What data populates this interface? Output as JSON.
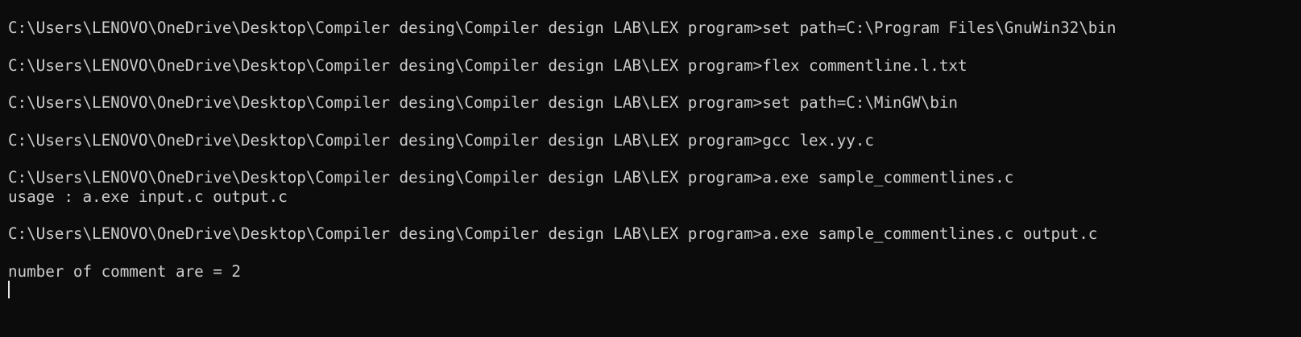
{
  "terminal": {
    "lines": [
      "C:\\Users\\LENOVO\\OneDrive\\Desktop\\Compiler desing\\Compiler design LAB\\LEX program>set path=C:\\Program Files\\GnuWin32\\bin",
      "",
      "C:\\Users\\LENOVO\\OneDrive\\Desktop\\Compiler desing\\Compiler design LAB\\LEX program>flex commentline.l.txt",
      "",
      "C:\\Users\\LENOVO\\OneDrive\\Desktop\\Compiler desing\\Compiler design LAB\\LEX program>set path=C:\\MinGW\\bin",
      "",
      "C:\\Users\\LENOVO\\OneDrive\\Desktop\\Compiler desing\\Compiler design LAB\\LEX program>gcc lex.yy.c",
      "",
      "C:\\Users\\LENOVO\\OneDrive\\Desktop\\Compiler desing\\Compiler design LAB\\LEX program>a.exe sample_commentlines.c",
      "usage : a.exe input.c output.c",
      "",
      "C:\\Users\\LENOVO\\OneDrive\\Desktop\\Compiler desing\\Compiler design LAB\\LEX program>a.exe sample_commentlines.c output.c",
      "",
      "number of comment are = 2"
    ],
    "colors": {
      "background": "#0c0c0c",
      "foreground": "#cccccc"
    }
  }
}
